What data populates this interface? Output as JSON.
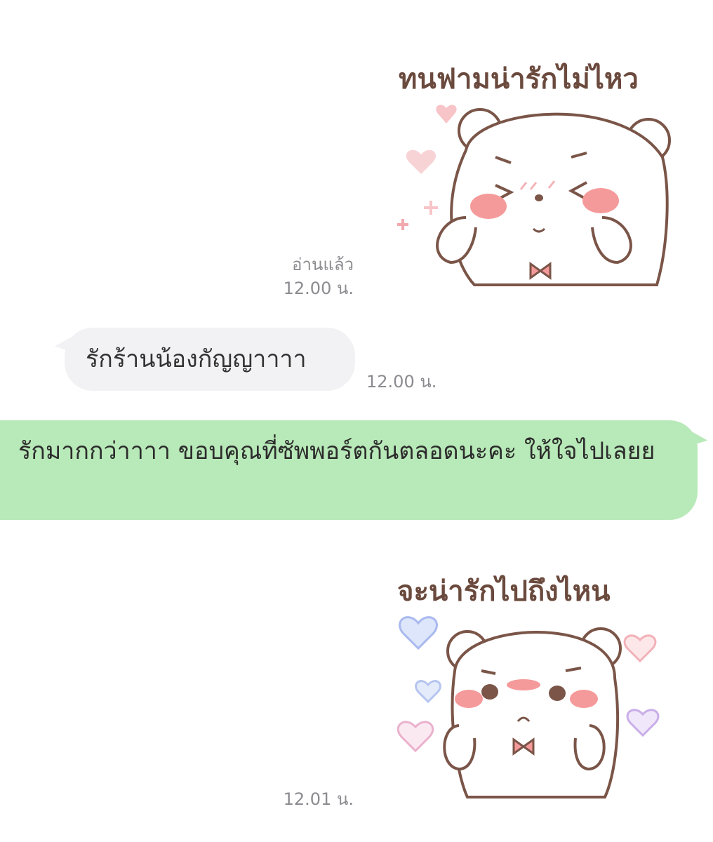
{
  "messages": {
    "sticker1": {
      "caption": "ทนฟามน่ารักไม่ไหว",
      "read": "อ่านแล้ว",
      "time": "12.00 น."
    },
    "incoming": {
      "text": "รักร้านน้องกัญญาาาา",
      "time": "12.00 น."
    },
    "outgoing": {
      "text": "รักมากกว่าาาา ขอบคุณที่ซัพพอร์ตกันตลอดนะคะ ให้ใจไปเลยย"
    },
    "sticker2": {
      "caption": "จะน่ารักไปถึงไหน",
      "time": "12.01 น."
    }
  },
  "colors": {
    "outgoing_bubble": "#b8e9b8",
    "incoming_bubble": "#f2f2f4",
    "bear_outline": "#7a5548",
    "blush": "#f59a9a"
  }
}
